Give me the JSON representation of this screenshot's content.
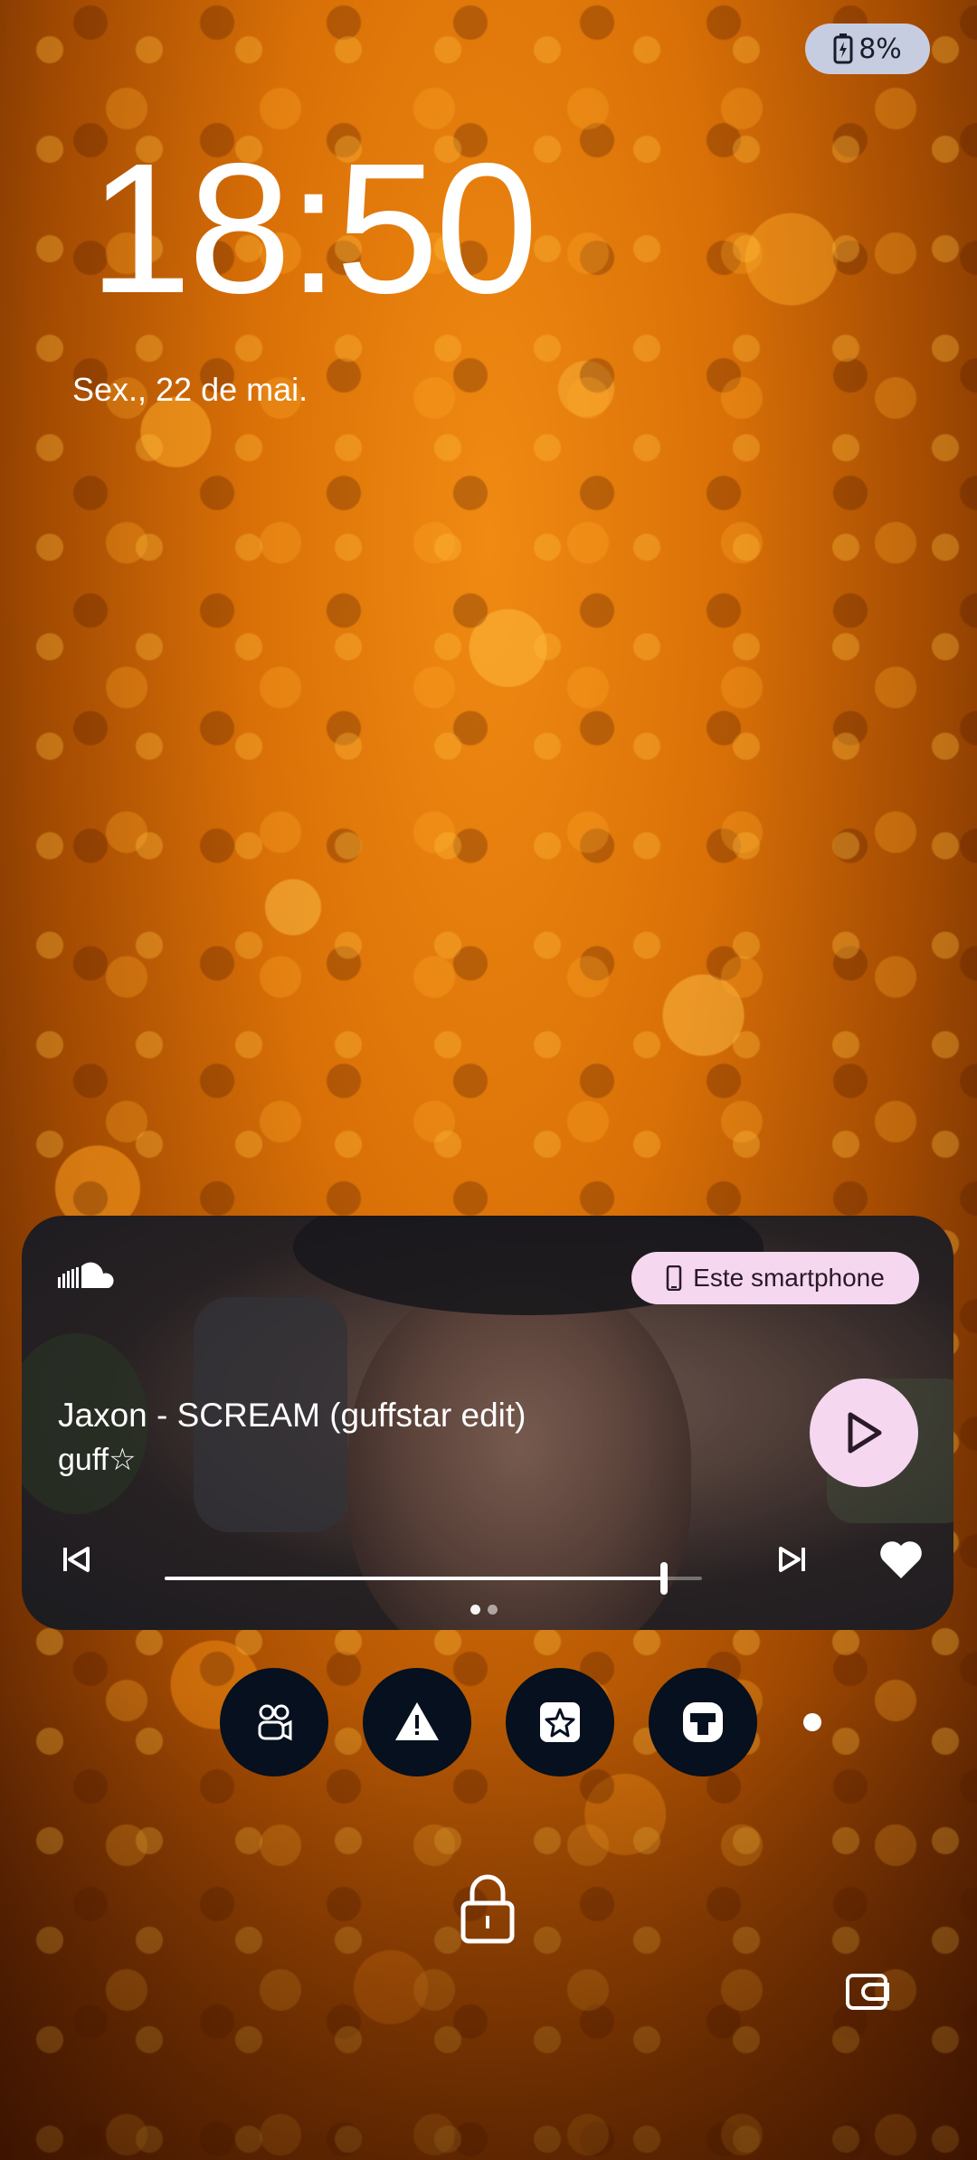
{
  "status_bar": {
    "battery_text": "8%",
    "battery_level": 0.08,
    "battery_icon": "battery-charging-icon"
  },
  "lockscreen": {
    "time": "18:50",
    "date": "Sex., 22 de mai."
  },
  "media": {
    "app_icon": "soundcloud-icon",
    "output_device": "Este smartphone",
    "title": "Jaxon - SCREAM (guffstar edit)",
    "artist": "guff☆",
    "progress": 0.93,
    "page_index": 1,
    "page_count": 2,
    "controls": {
      "play": "play-icon",
      "previous": "skip-previous-icon",
      "next": "skip-next-icon",
      "like": "heart-icon"
    }
  },
  "shortcuts": [
    {
      "icon": "shortcut-app-1-icon"
    },
    {
      "icon": "warning-icon"
    },
    {
      "icon": "star-square-icon"
    },
    {
      "icon": "shortcut-app-4-icon"
    }
  ],
  "colors": {
    "chip_pink": "#f5d7f0",
    "battery_pill": "#c7cde0",
    "shortcut_bg": "#06101e"
  }
}
